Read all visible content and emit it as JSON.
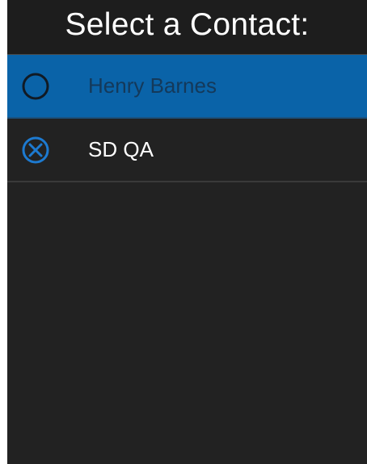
{
  "header": {
    "title": "Select a Contact:"
  },
  "contacts": [
    {
      "name": "Henry Barnes",
      "state": "selected",
      "icon": "radio-unchecked-icon"
    },
    {
      "name": "SD QA",
      "state": "normal",
      "icon": "circle-x-icon"
    }
  ],
  "colors": {
    "background": "#222222",
    "header_background": "#1d1d1d",
    "selected_row": "#0a63a8",
    "selected_text": "#14395a",
    "text": "#ffffff",
    "accent": "#1d7ad0"
  }
}
